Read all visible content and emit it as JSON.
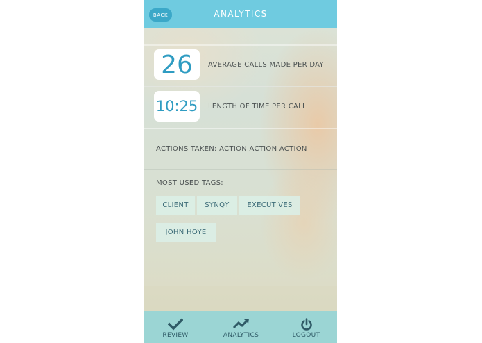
{
  "header": {
    "back_label": "BACK",
    "title": "ANALYTICS"
  },
  "stats": [
    {
      "value": "26",
      "label": "AVERAGE CALLS MADE PER DAY"
    },
    {
      "value": "10:25",
      "label": "LENGTH OF TIME PER CALL"
    }
  ],
  "actions_text": "ACTIONS TAKEN: ACTION ACTION ACTION",
  "tags": {
    "heading": "MOST USED TAGS:",
    "items": [
      "CLIENT",
      "SYNQY",
      "EXECUTIVES",
      "JOHN HOYE"
    ]
  },
  "tabbar": {
    "items": [
      {
        "label": "REVIEW",
        "icon": "checkmark-icon"
      },
      {
        "label": "ANALYTICS",
        "icon": "trend-up-icon"
      },
      {
        "label": "LOGOUT",
        "icon": "power-icon"
      }
    ]
  },
  "colors": {
    "header_bg": "#6fcbe0",
    "back_button": "#3ba8c8",
    "stat_number": "#2f9cc2",
    "tabbar_bg": "#9bd5d4",
    "tag_bg": "#daf0e8"
  }
}
